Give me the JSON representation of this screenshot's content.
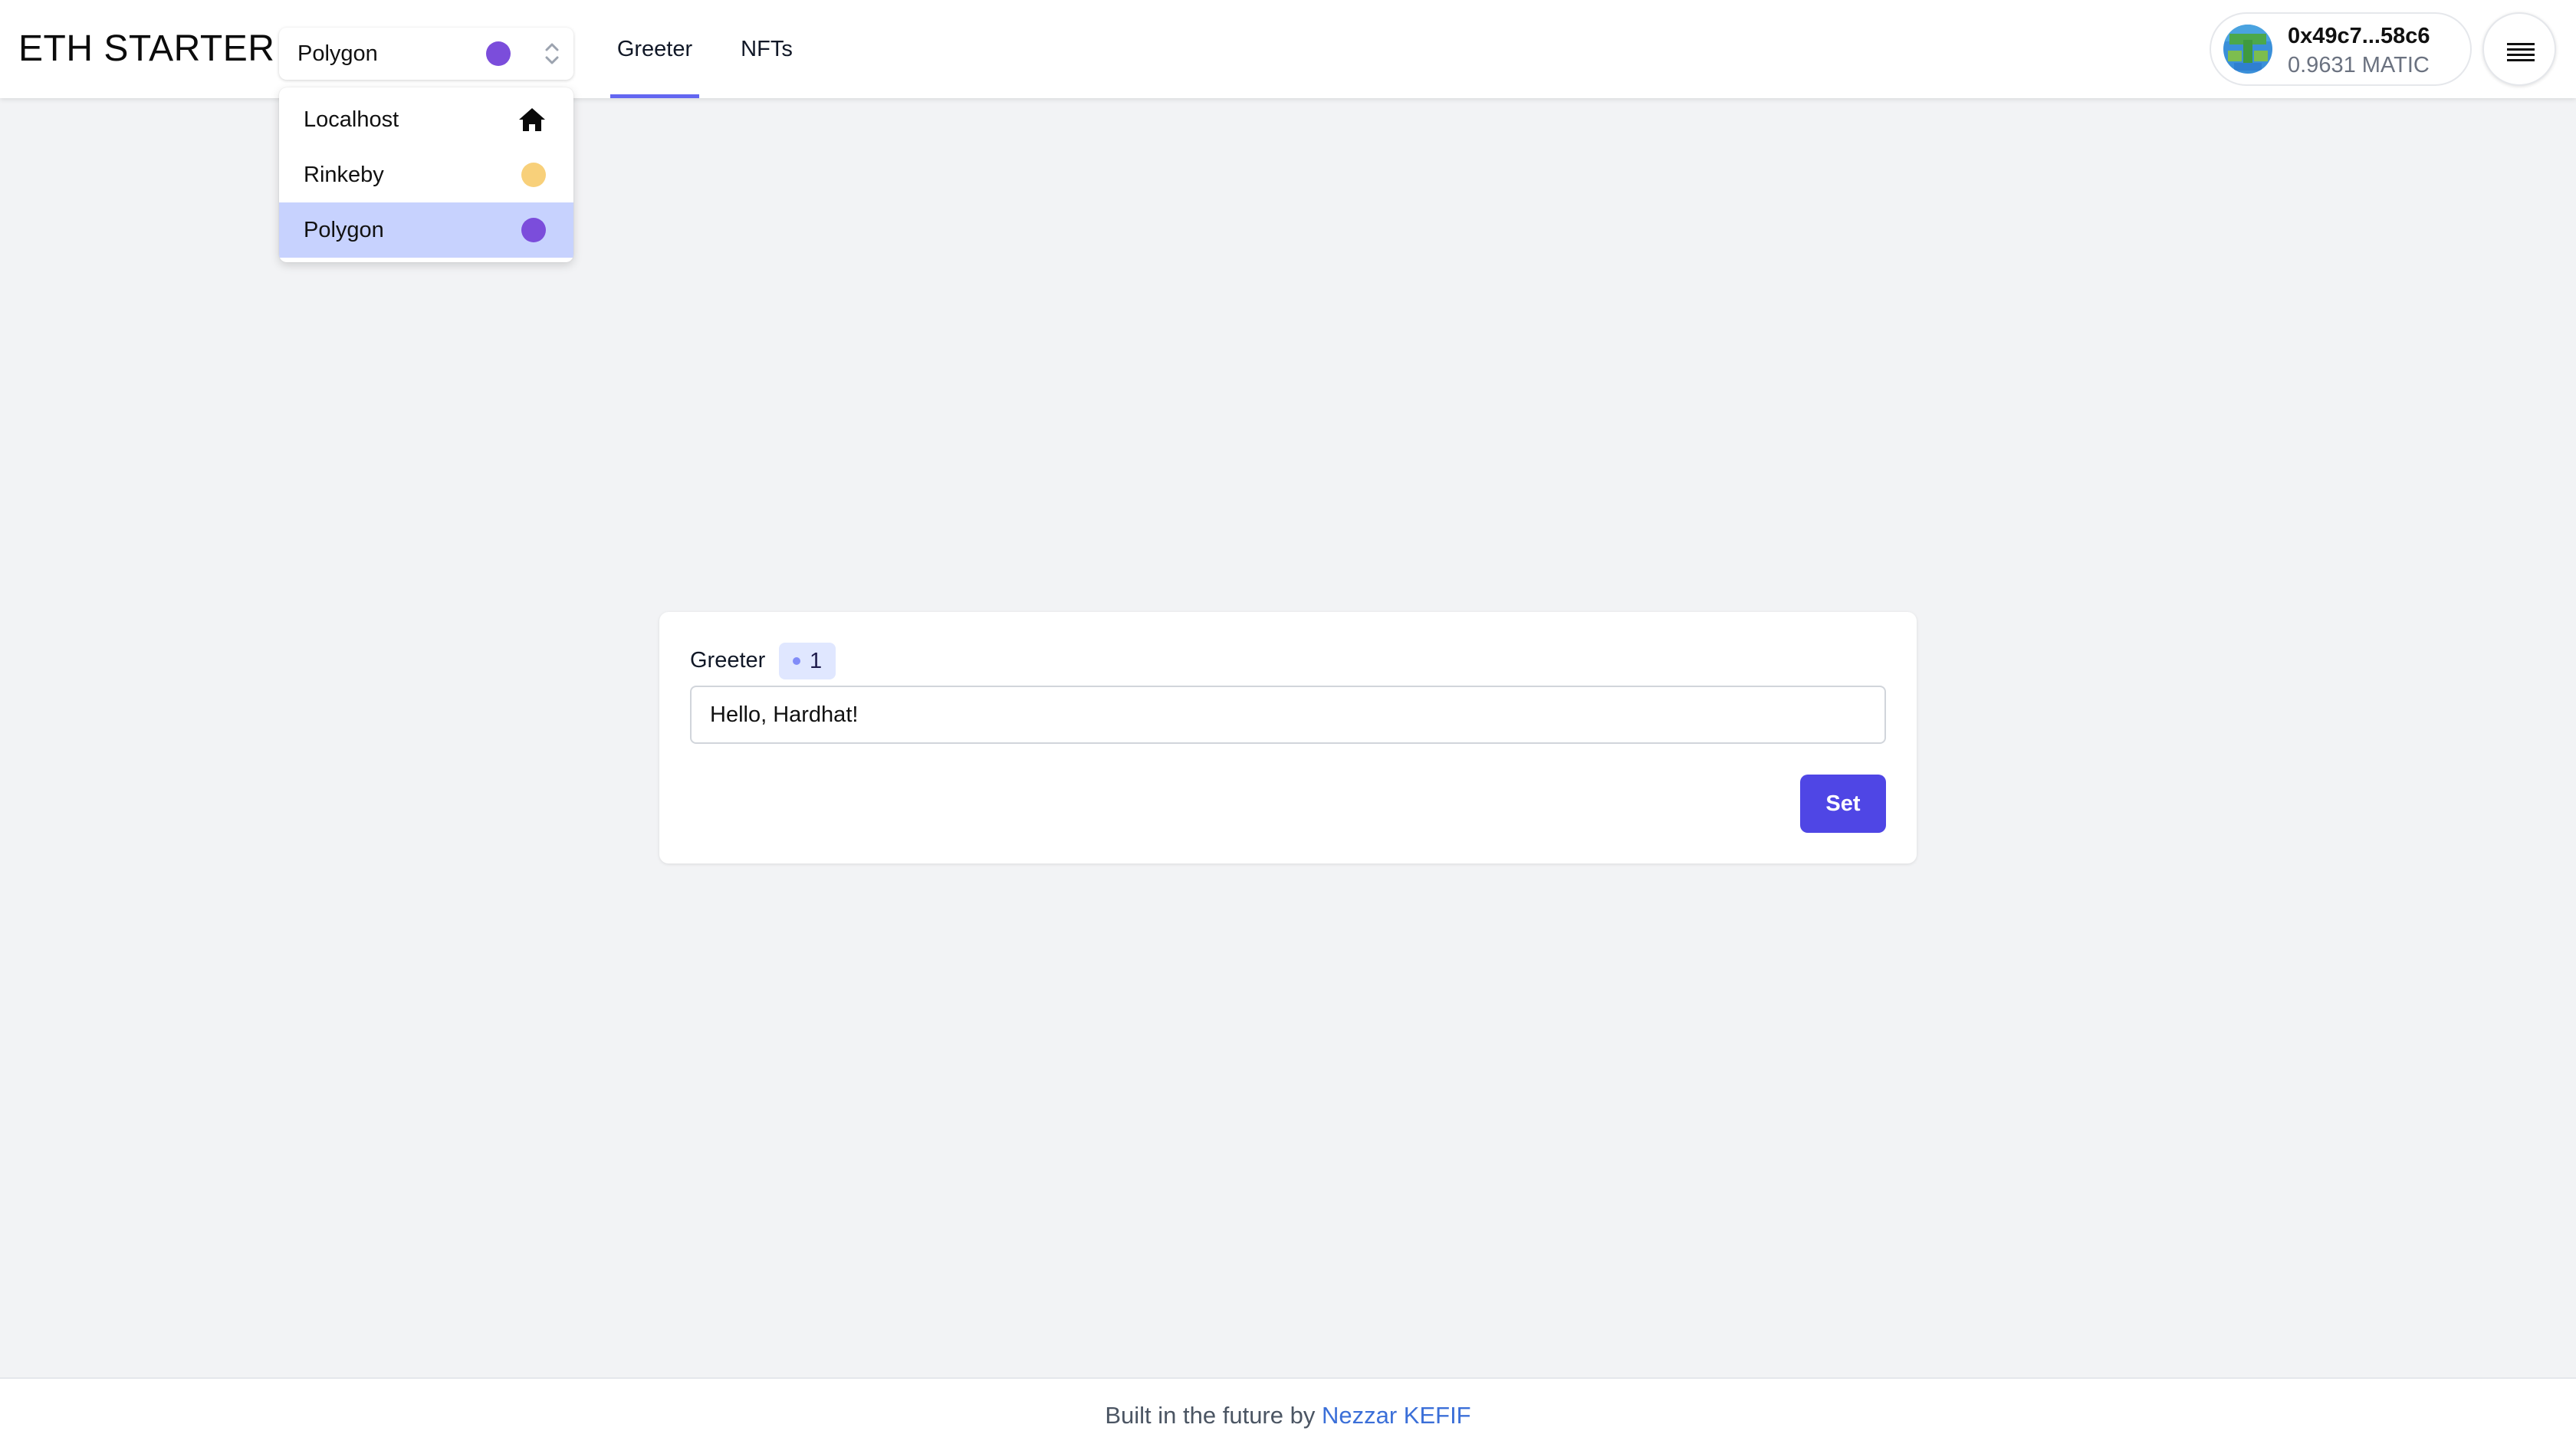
{
  "header": {
    "brand": "ETH STARTER",
    "network_select": {
      "selected": "Polygon",
      "selected_color": "#7b4ddb"
    },
    "tabs": [
      {
        "label": "Greeter",
        "active": true
      },
      {
        "label": "NFTs",
        "active": false
      }
    ],
    "wallet": {
      "address": "0x49c7...58c6",
      "balance": "0.9631 MATIC"
    },
    "menu_icon": "hamburger-icon"
  },
  "network_dropdown": {
    "items": [
      {
        "label": "Localhost",
        "icon": "home-icon"
      },
      {
        "label": "Rinkeby",
        "color": "#f8d07a"
      },
      {
        "label": "Polygon",
        "color": "#7b4ddb",
        "selected": true
      }
    ]
  },
  "greeter_card": {
    "title": "Greeter",
    "badge_count": "1",
    "input_value": "Hello, Hardhat!",
    "set_label": "Set"
  },
  "footer": {
    "text": "Built in the future by ",
    "link_text": "Nezzar KEFIF"
  },
  "colors": {
    "accent": "#4f46e5",
    "tab_underline": "#6366f1",
    "selected_row": "#c7d2fe",
    "badge_bg": "#e0e7ff"
  }
}
